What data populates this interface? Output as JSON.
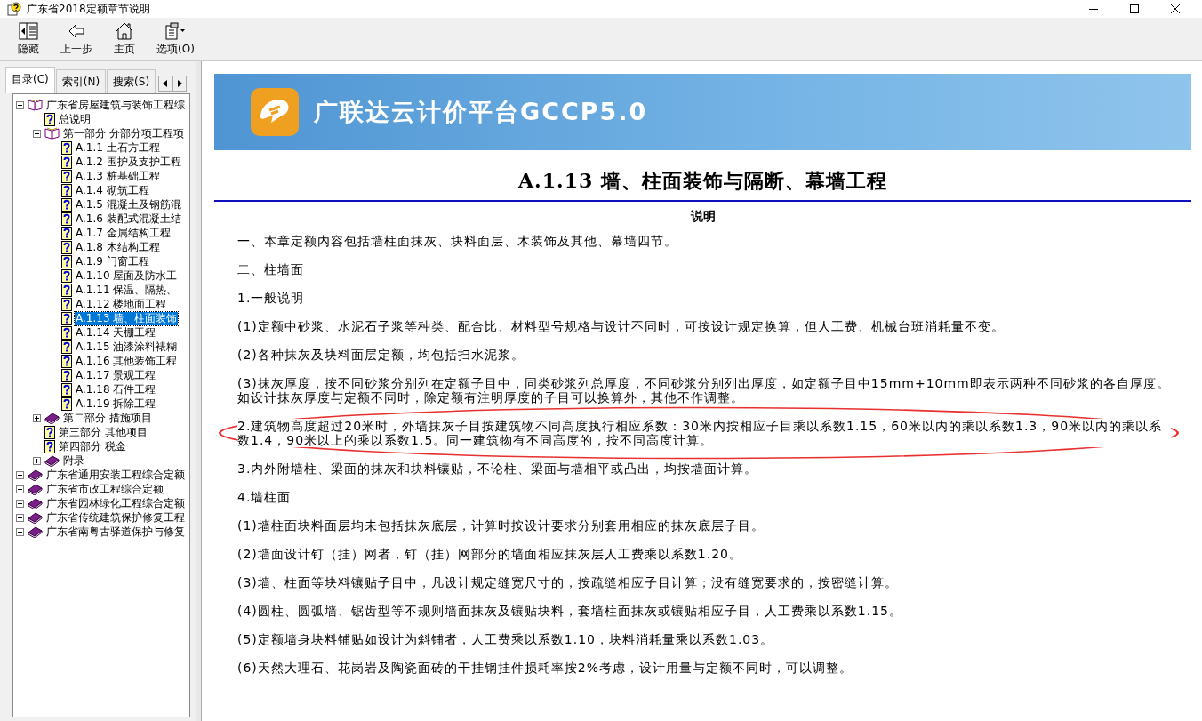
{
  "window": {
    "title": "广东省2018定额章节说明"
  },
  "toolbar": [
    {
      "kind": "hide",
      "label": "隐藏"
    },
    {
      "kind": "back",
      "label": "上一步"
    },
    {
      "kind": "home",
      "label": "主页"
    },
    {
      "kind": "options",
      "label": "选项(O)"
    }
  ],
  "tabs": [
    {
      "label": "目录(C)",
      "selected": true
    },
    {
      "label": "索引(N)",
      "selected": false
    },
    {
      "label": "搜索(S)",
      "selected": false
    }
  ],
  "tree": [
    {
      "label": "广东省房屋建筑与装饰工程综",
      "kind": "book",
      "expanded": true,
      "selected": false,
      "children": [
        {
          "label": "总说明",
          "kind": "page",
          "selected": false
        },
        {
          "label": "第一部分 分部分项工程项",
          "kind": "book",
          "expanded": true,
          "selected": false,
          "children": [
            {
              "label": "A.1.1 土石方工程",
              "kind": "page",
              "selected": false
            },
            {
              "label": "A.1.2 围护及支护工程",
              "kind": "page",
              "selected": false
            },
            {
              "label": "A.1.3 桩基础工程",
              "kind": "page",
              "selected": false
            },
            {
              "label": "A.1.4 砌筑工程",
              "kind": "page",
              "selected": false
            },
            {
              "label": "A.1.5 混凝土及钢筋混",
              "kind": "page",
              "selected": false
            },
            {
              "label": "A.1.6 装配式混凝土结",
              "kind": "page",
              "selected": false
            },
            {
              "label": "A.1.7 金属结构工程",
              "kind": "page",
              "selected": false
            },
            {
              "label": "A.1.8 木结构工程",
              "kind": "page",
              "selected": false
            },
            {
              "label": "A.1.9 门窗工程",
              "kind": "page",
              "selected": false
            },
            {
              "label": "A.1.10 屋面及防水工",
              "kind": "page",
              "selected": false
            },
            {
              "label": "A.1.11 保温、隔热、",
              "kind": "page",
              "selected": false
            },
            {
              "label": "A.1.12 楼地面工程",
              "kind": "page",
              "selected": false
            },
            {
              "label": "A.1.13 墙、柱面装饰",
              "kind": "page",
              "selected": true
            },
            {
              "label": "A.1.14 天棚工程",
              "kind": "page",
              "selected": false
            },
            {
              "label": "A.1.15 油漆涂料裱糊",
              "kind": "page",
              "selected": false
            },
            {
              "label": "A.1.16 其他装饰工程",
              "kind": "page",
              "selected": false
            },
            {
              "label": "A.1.17 景观工程",
              "kind": "page",
              "selected": false
            },
            {
              "label": "A.1.18 石件工程",
              "kind": "page",
              "selected": false
            },
            {
              "label": "A.1.19 拆除工程",
              "kind": "page",
              "selected": false
            }
          ]
        },
        {
          "label": "第二部分 措施项目",
          "kind": "book",
          "expanded": false,
          "selected": false
        },
        {
          "label": "第三部分 其他项目",
          "kind": "page",
          "selected": false
        },
        {
          "label": "第四部分 税金",
          "kind": "page",
          "selected": false
        },
        {
          "label": "附录",
          "kind": "book",
          "expanded": false,
          "selected": false
        }
      ]
    },
    {
      "label": "广东省通用安装工程综合定额",
      "kind": "book",
      "expanded": false,
      "selected": false
    },
    {
      "label": "广东省市政工程综合定额",
      "kind": "book",
      "expanded": false,
      "selected": false
    },
    {
      "label": "广东省园林绿化工程综合定额",
      "kind": "book",
      "expanded": false,
      "selected": false
    },
    {
      "label": "广东省传统建筑保护修复工程",
      "kind": "book",
      "expanded": false,
      "selected": false
    },
    {
      "label": "广东省南粤古驿道保护与修复",
      "kind": "book",
      "expanded": false,
      "selected": false
    }
  ],
  "banner": {
    "title": "广联达云计价平台GCCP5.0"
  },
  "document": {
    "heading": "A.1.13 墙、柱面装饰与隔断、幕墙工程",
    "subheading": "说明",
    "paragraphs": [
      {
        "text": "一、本章定额内容包括墙柱面抹灰、块料面层、木装饰及其他、幕墙四节。",
        "circled": false
      },
      {
        "text": "二、柱墙面",
        "circled": false
      },
      {
        "text": "1.一般说明",
        "circled": false
      },
      {
        "text": "(1)定额中砂浆、水泥石子浆等种类、配合比、材料型号规格与设计不同时，可按设计规定换算，但人工费、机械台班消耗量不变。",
        "circled": false
      },
      {
        "text": "(2)各种抹灰及块料面层定额，均包括扫水泥浆。",
        "circled": false
      },
      {
        "text": "(3)抹灰厚度，按不同砂浆分别列在定额子目中，同类砂浆列总厚度，不同砂浆分别列出厚度，如定额子目中15mm+10mm即表示两种不同砂浆的各自厚度。如设计抹灰厚度与定额不同时，除定额有注明厚度的子目可以换算外，其他不作调整。",
        "circled": false
      },
      {
        "text": "2.建筑物高度超过20米时，外墙抹灰子目按建筑物不同高度执行相应系数：30米内按相应子目乘以系数1.15，60米以内的乘以系数1.3，90米以内的乘以系数1.4，90米以上的乘以系数1.5。同一建筑物有不同高度的，按不同高度计算。",
        "circled": true
      },
      {
        "text": "3.内外附墙柱、梁面的抹灰和块料镶贴，不论柱、梁面与墙相平或凸出，均按墙面计算。",
        "circled": false
      },
      {
        "text": "4.墙柱面",
        "circled": false
      },
      {
        "text": "(1)墙柱面块料面层均未包括抹灰底层，计算时按设计要求分别套用相应的抹灰底层子目。",
        "circled": false
      },
      {
        "text": "(2)墙面设计钉（挂）网者，钉（挂）网部分的墙面相应抹灰层人工费乘以系数1.20。",
        "circled": false
      },
      {
        "text": "(3)墙、柱面等块料镶贴子目中，凡设计规定缝宽尺寸的，按疏缝相应子目计算；没有缝宽要求的，按密缝计算。",
        "circled": false
      },
      {
        "text": "(4)圆柱、圆弧墙、锯齿型等不规则墙面抹灰及镶贴块料，套墙柱面抹灰或镶贴相应子目，人工费乘以系数1.15。",
        "circled": false
      },
      {
        "text": "(5)定额墙身块料铺贴如设计为斜铺者，人工费乘以系数1.10，块料消耗量乘以系数1.03。",
        "circled": false
      },
      {
        "text": "(6)天然大理石、花岗岩及陶瓷面砖的干挂钢挂件损耗率按2%考虑，设计用量与定额不同时，可以调整。",
        "circled": false
      }
    ]
  }
}
